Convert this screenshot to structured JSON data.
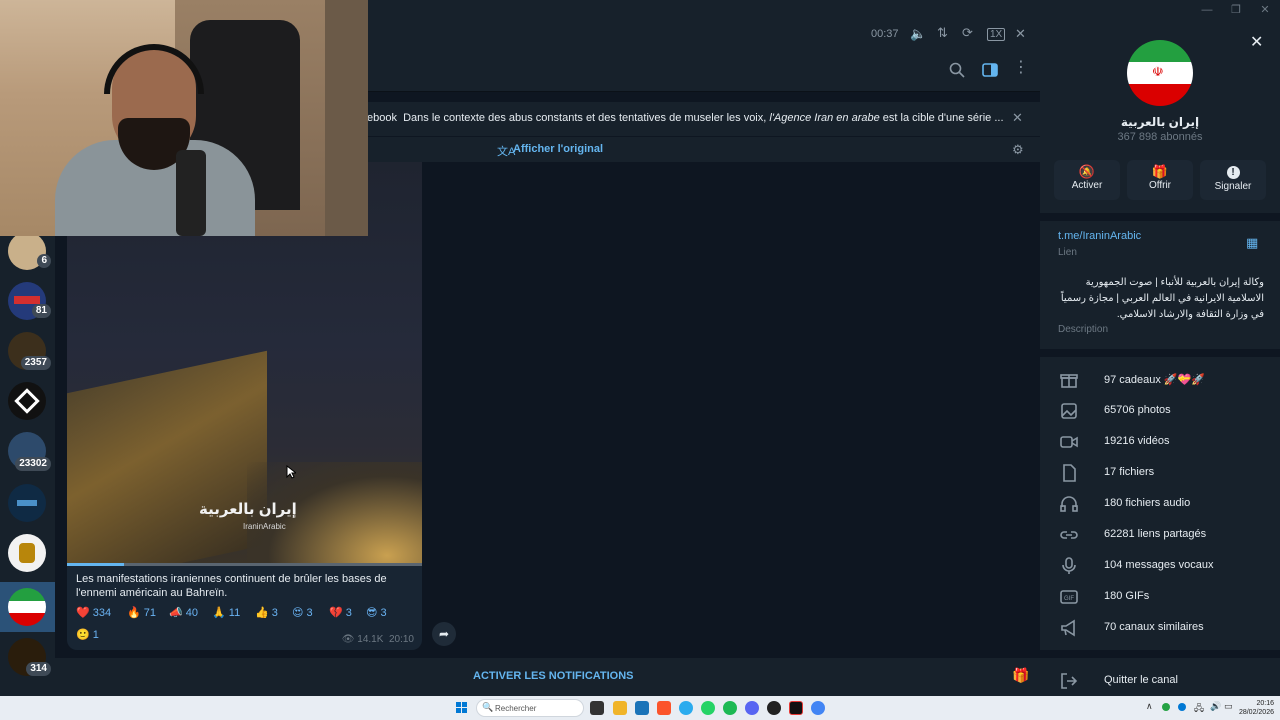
{
  "audio_player": {
    "time": "00:37",
    "speed": "1X"
  },
  "pinned": {
    "source": "ebook",
    "text_plain": "Dans le contexte des abus constants et des tentatives de museler les voix,",
    "text_italic": "l'Agence Iran en arabe",
    "text_tail": "est la cible d'une série ..."
  },
  "translate": {
    "label": "Afficher l'original"
  },
  "sidebar": {
    "chats": [
      {
        "name": "chat-1",
        "badge": "6"
      },
      {
        "name": "chat-2",
        "badge": "81"
      },
      {
        "name": "chat-3",
        "badge": "2357"
      },
      {
        "name": "chat-4",
        "badge": ""
      },
      {
        "name": "chat-5",
        "badge": "23302"
      },
      {
        "name": "chat-6",
        "badge": ""
      },
      {
        "name": "chat-7",
        "badge": ""
      },
      {
        "name": "chat-8",
        "badge": ""
      },
      {
        "name": "chat-9",
        "badge": "314"
      }
    ]
  },
  "message": {
    "watermark_title": "إيران بالعربية",
    "watermark_handle": "IraninArabic",
    "caption_line1": "Les manifestations iraniennes continuent de brûler les bases de",
    "caption_line2": "l'ennemi américain au Bahreïn.",
    "reactions": [
      {
        "emoji": "❤️",
        "count": "334"
      },
      {
        "emoji": "🔥",
        "count": "71"
      },
      {
        "emoji": "📣",
        "count": "40"
      },
      {
        "emoji": "🙏",
        "count": "11"
      },
      {
        "emoji": "👍",
        "count": "3"
      },
      {
        "emoji": "😍",
        "count": "3"
      },
      {
        "emoji": "💔",
        "count": "3"
      },
      {
        "emoji": "😎",
        "count": "3"
      }
    ],
    "reaction_extra": {
      "emoji": "🙂",
      "count": "1"
    },
    "views": "14.1K",
    "time": "20:10"
  },
  "bottom_bar": {
    "action_label": "ACTIVER LES NOTIFICATIONS"
  },
  "info": {
    "channel_name": "إيران بالعربية",
    "subscribers": "367 898 abonnés",
    "actions": {
      "mute": "Activer",
      "gift": "Offrir",
      "report": "Signaler"
    },
    "link": "t.me/IraninArabic",
    "link_label": "Lien",
    "description_line1": "وكالة إيران بالعربية للأنباء | صوت الجمهورية",
    "description_line2": "الاسلامية الايرانية في العالم العربي | مجازة رسمياً",
    "description_line3": "في وزارة الثقافة والارشاد الاسلامي.",
    "description_label": "Description",
    "stats": [
      {
        "icon": "gift-icon",
        "label": "97 cadeaux 🚀💝🚀"
      },
      {
        "icon": "photo-icon",
        "label": "65706 photos"
      },
      {
        "icon": "video-icon",
        "label": "19216 vidéos"
      },
      {
        "icon": "file-icon",
        "label": "17 fichiers"
      },
      {
        "icon": "headphones-icon",
        "label": "180 fichiers audio"
      },
      {
        "icon": "link-icon",
        "label": "62281 liens partagés"
      },
      {
        "icon": "microphone-icon",
        "label": "104 messages vocaux"
      },
      {
        "icon": "gif-icon",
        "label": "180 GIFs"
      },
      {
        "icon": "megaphone-icon",
        "label": "70 canaux similaires"
      }
    ],
    "leave": "Quitter le canal"
  },
  "taskbar": {
    "search_placeholder": "Rechercher",
    "clock_time": "20:16",
    "clock_date": "28/02/2026"
  },
  "colors": {
    "accent": "#64b5ef",
    "active_chat": "#2b5278",
    "panel": "#17212b",
    "background": "#0e1621"
  }
}
